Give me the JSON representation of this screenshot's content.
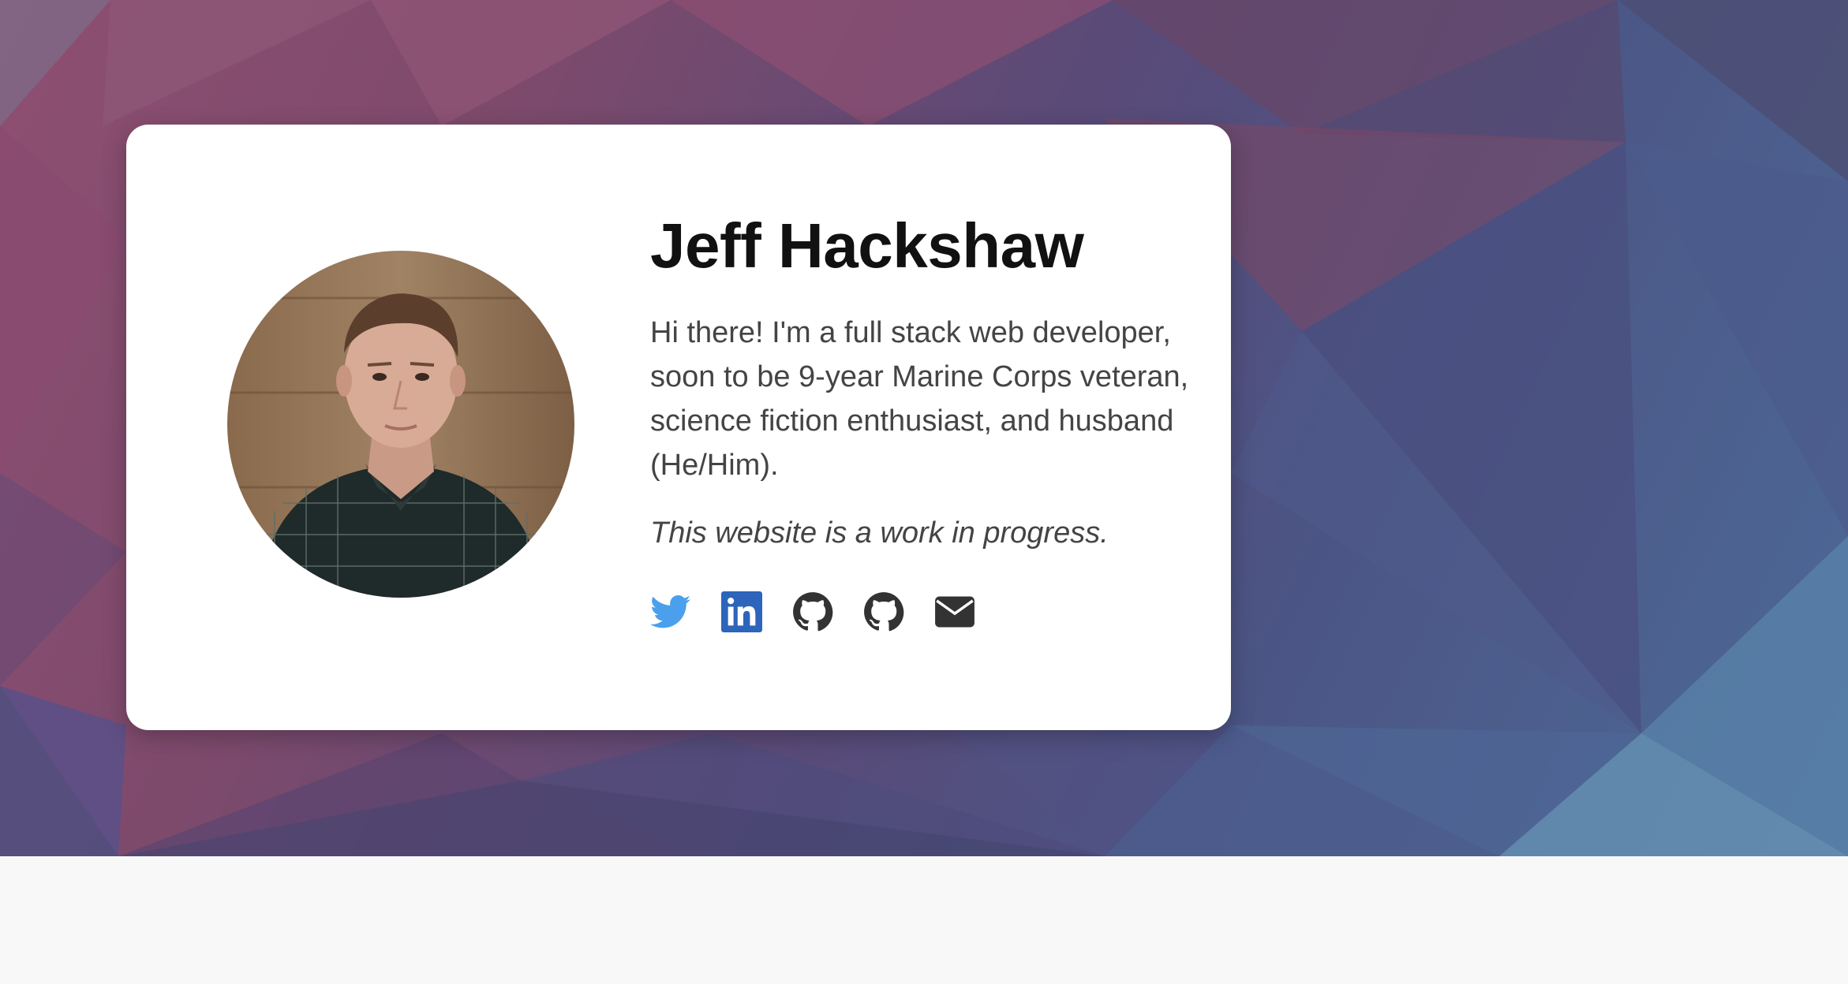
{
  "profile": {
    "name": "Jeff Hackshaw",
    "bio": "Hi there! I'm a full stack web developer, soon to be 9-year Marine Corps veteran, science fiction enthusiast, and husband (He/Him).",
    "note": "This website is a work in progress."
  },
  "socials": [
    {
      "icon": "twitter-icon",
      "color": "#4aa0ec"
    },
    {
      "icon": "linkedin-icon",
      "color": "#2d64bc"
    },
    {
      "icon": "github-icon",
      "color": "#333333"
    },
    {
      "icon": "github-icon",
      "color": "#333333"
    },
    {
      "icon": "mail-icon",
      "color": "#333333"
    }
  ],
  "colors": {
    "background_top": "#8e4f72",
    "background_bottom": "#4d6a98",
    "card": "#ffffff",
    "footer": "#f8f8f8"
  }
}
